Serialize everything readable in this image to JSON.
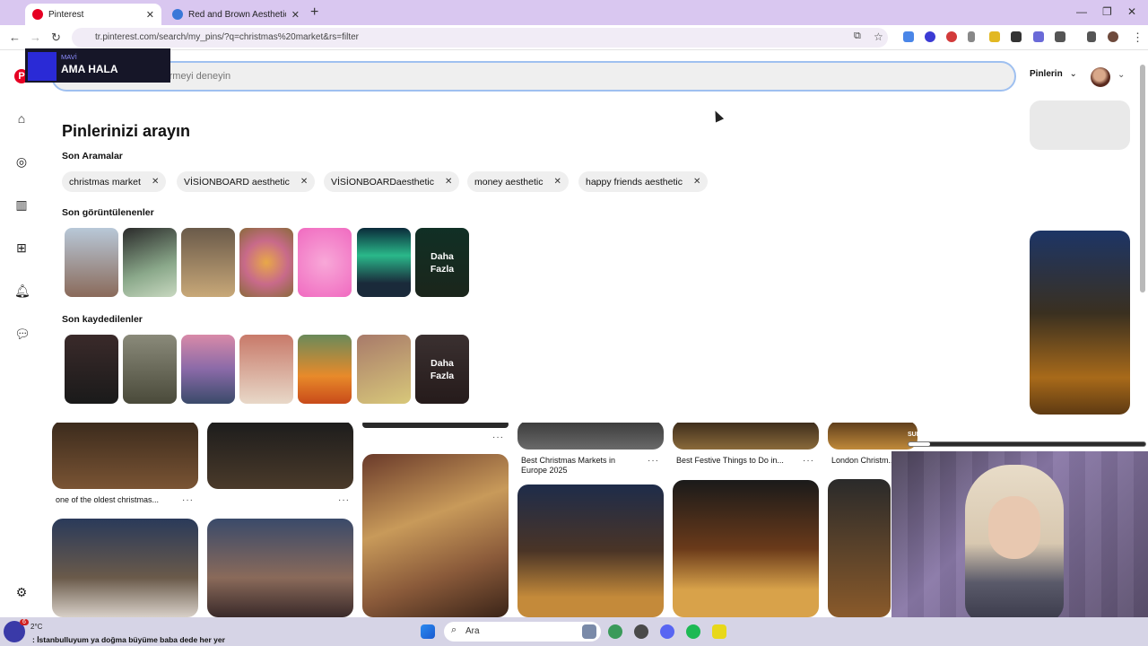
{
  "browser": {
    "tabs": [
      {
        "title": "Pinterest",
        "active": true
      },
      {
        "title": "Red and Brown Aesthetic Vision",
        "active": false
      }
    ],
    "new_tab_symbol": "+",
    "url": "tr.pinterest.com/search/my_pins/?q=christmas%20market&rs=filter",
    "window_controls": {
      "minimize": "—",
      "maximize": "❐",
      "close": "✕"
    }
  },
  "pinterest": {
    "search": {
      "placeholder": "Pin'leri veya açıklama girmeyi deneyin"
    },
    "filter_label": "Pinlerin",
    "left_rail_icons": [
      "pinterest-logo",
      "home-icon",
      "explore-icon",
      "boards-icon",
      "create-icon",
      "notifications-icon",
      "messages-icon",
      "settings-icon"
    ],
    "dropdown": {
      "title": "Pinlerinizi arayın",
      "recent_searches_label": "Son Aramalar",
      "recent_searches": [
        "christmas market",
        "VİSİONBOARD aesthetic",
        "VİSİONBOARDaesthetic",
        "money aesthetic",
        "happy friends aesthetic"
      ],
      "recently_viewed_label": "Son görüntülenenler",
      "recently_saved_label": "Son kaydedilenler",
      "more_label_line1": "Daha",
      "more_label_line2": "Fazla"
    },
    "background_pins": [
      {
        "caption": "one of the oldest christmas..."
      },
      {
        "caption": "Best Christmas Markets in Europe 2025"
      },
      {
        "caption": "Best Festive Things to Do in..."
      },
      {
        "caption": "London Christm..."
      }
    ]
  },
  "overlay": {
    "small_text": "MAVİ",
    "big_text": "AMA HALA",
    "sub_goal_label": "SUB HEDEF",
    "sub_goal_progress": 0.09
  },
  "taskbar": {
    "search_placeholder": "Ara",
    "weather": "2°C",
    "ticker_text": ": İstanbulluyum ya doğma büyüme baba dede her yer",
    "notification_count": "6"
  }
}
